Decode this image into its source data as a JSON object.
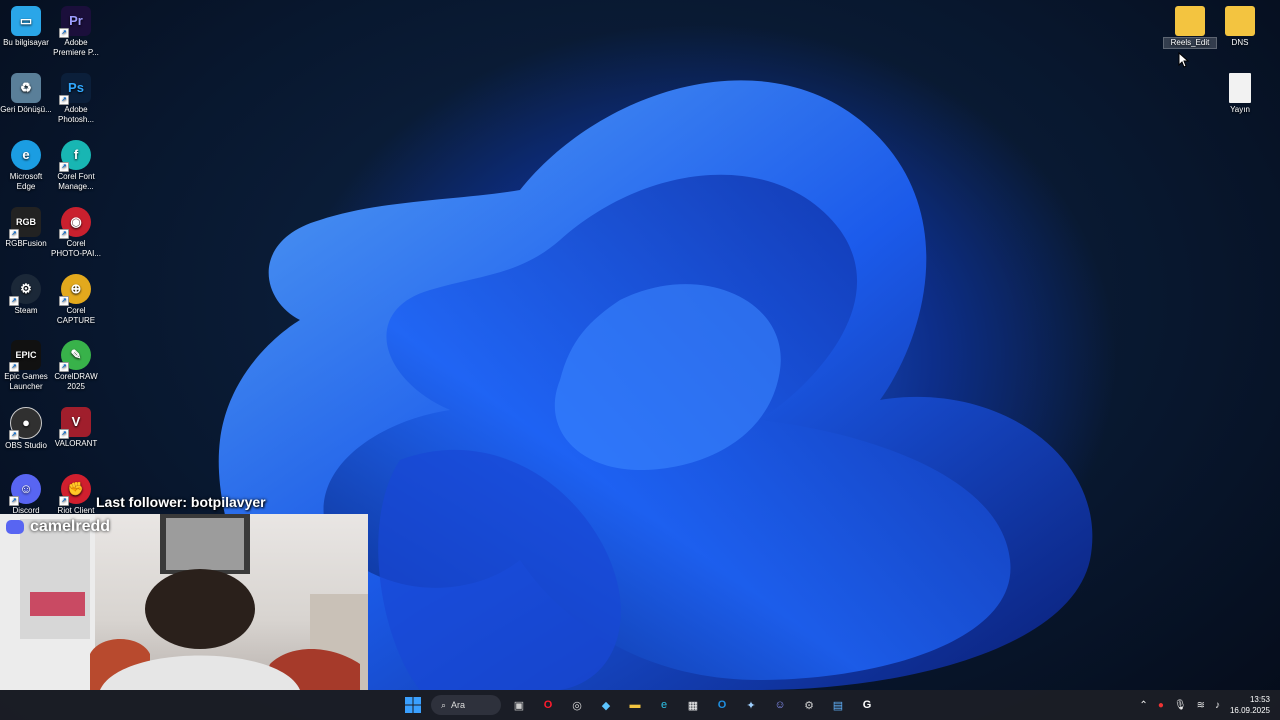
{
  "desktop": {
    "left_icons": [
      {
        "label": "Bu bilgisayar",
        "icon": "computer-icon",
        "color": "#2aa6e8"
      },
      {
        "label": "Adobe Premiere P...",
        "icon": "premiere-icon",
        "color": "#1b0f3b"
      },
      {
        "label": "Geri Dönüşü...",
        "icon": "recycle-bin-icon",
        "color": "#5a7f99"
      },
      {
        "label": "Adobe Photosh...",
        "icon": "photoshop-icon",
        "color": "#0b1f3a"
      },
      {
        "label": "Microsoft Edge",
        "icon": "edge-icon",
        "color": "#1b9de2"
      },
      {
        "label": "Corel Font Manage...",
        "icon": "corel-font-icon",
        "color": "#18b6b3"
      },
      {
        "label": "RGBFusion",
        "icon": "rgbfusion-icon",
        "color": "#222222"
      },
      {
        "label": "Corel PHOTO-PAI...",
        "icon": "corel-photopaint-icon",
        "color": "#c9202e"
      },
      {
        "label": "Steam",
        "icon": "steam-icon",
        "color": "#1b2838"
      },
      {
        "label": "Corel CAPTURE",
        "icon": "corel-capture-icon",
        "color": "#e3a91d"
      },
      {
        "label": "Epic Games Launcher",
        "icon": "epic-games-icon",
        "color": "#111111"
      },
      {
        "label": "CorelDRAW 2025",
        "icon": "coreldraw-icon",
        "color": "#38b24a"
      },
      {
        "label": "OBS Studio",
        "icon": "obs-icon",
        "color": "#303030"
      },
      {
        "label": "VALORANT",
        "icon": "valorant-icon",
        "color": "#a01e2c"
      },
      {
        "label": "Discord",
        "icon": "discord-icon",
        "color": "#5865f2"
      },
      {
        "label": "Riot Client",
        "icon": "riot-client-icon",
        "color": "#d01f2e"
      }
    ],
    "right_icons": [
      {
        "label": "Reels_Edit",
        "icon": "folder-icon",
        "color": "#f3c440"
      },
      {
        "label": "DNS",
        "icon": "folder-icon",
        "color": "#f3c440"
      },
      {
        "label": "Yayın",
        "icon": "text-file-icon",
        "color": "#f2f2f2"
      }
    ]
  },
  "stream_overlay": {
    "last_follower": "Last follower: botpilavyer",
    "webcam_username": "camelredd"
  },
  "taskbar": {
    "search_label": "Ara",
    "pinned": [
      "start-icon",
      "task-view-icon",
      "opera-icon",
      "chatgpt-icon",
      "m365-icon",
      "file-explorer-icon",
      "edge-icon",
      "microsoft-store-icon",
      "outlook-icon",
      "app-icon",
      "discord-icon",
      "steam-icon",
      "notepad-icon",
      "logitech-g-icon"
    ],
    "time": "13:53",
    "date": "16.09.2025"
  }
}
